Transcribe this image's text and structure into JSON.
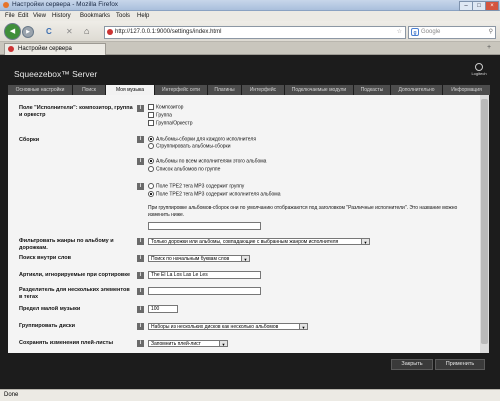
{
  "window": {
    "title": "Настройки сервера - Mozilla Firefox",
    "controls": {
      "minimize": "–",
      "maximize": "□",
      "close": "×"
    }
  },
  "menu": [
    "File",
    "Edit",
    "View",
    "History",
    "Bookmarks",
    "Tools",
    "Help"
  ],
  "navbar": {
    "back_icon": "◀",
    "forward_icon": "▶",
    "reload_icon": "C",
    "stop_icon": "✕",
    "home_icon": "⌂",
    "url": "http://127.0.0.1:9000/settings/index.html",
    "search_placeholder": "Google"
  },
  "browser_tab": {
    "label": "Настройки сервера"
  },
  "app": {
    "title": "Squeezebox™ Server",
    "logo_text": "Logitech",
    "tabs": [
      "Основные настройки",
      "Поиск",
      "Моя музыка",
      "Интерфейс сети",
      "Плагины",
      "Интерфейс",
      "Подключаемые модули",
      "Подкасты",
      "Дополнительно",
      "Информация"
    ],
    "active_tab_index": 2
  },
  "settings": {
    "hint_icon": "i",
    "composer": {
      "label": "Поле \"Исполнители\": композитор, группа и оркестр",
      "options": [
        {
          "text": "Композитор",
          "checked": false
        },
        {
          "text": "Группа",
          "checked": false
        },
        {
          "text": "Группа/Оркестр",
          "checked": false
        }
      ]
    },
    "compilations": {
      "label": "Сборки",
      "group1": [
        {
          "text": "Альбомы-сборки для каждого исполнителя",
          "checked": true
        },
        {
          "text": "Сгруппировать альбомы-сборки",
          "checked": false
        }
      ],
      "group2": [
        {
          "text": "Альбомы по всем исполнителям этого альбома",
          "checked": true
        },
        {
          "text": "Список альбомов по группе",
          "checked": false
        }
      ],
      "group3": [
        {
          "text": "Поле TPE2 тега MP3 содержит группу",
          "checked": false
        },
        {
          "text": "Поле TPE2 тега MP3 содержит исполнителя альбома",
          "checked": true
        }
      ],
      "note": "При группировке альбомов-сборок они по умолчанию отображаются под заголовком \"Различные исполнители\". Это название можно изменить ниже.",
      "name_value": ""
    },
    "genre_filter": {
      "label": "Фильтровать жанры по альбому и дорожкам.",
      "value": "Только дорожки или альбомы, совпадающие с выбранным жанром исполнителя"
    },
    "word_search": {
      "label": "Поиск внутри слов",
      "value": "Поиск по начальным буквам слов"
    },
    "articles": {
      "label": "Артикли, игнорируемые при сортировке",
      "value": "The El La Los Las Le Les"
    },
    "separators": {
      "label": "Разделитель для нескольких элементов в тегах",
      "value": ""
    },
    "short_music": {
      "label": "Предел малой музыки",
      "value": "100"
    },
    "group_discs": {
      "label": "Группировать диски",
      "value": "Наборы из нескольких дисков как несколько альбомов"
    },
    "playlist_edits": {
      "label": "Сохранять изменения плей-листы",
      "value": "Запомнить плей-лист"
    }
  },
  "buttons": {
    "close": "Закрыть",
    "apply": "Применить"
  },
  "status": "Done",
  "colors": {
    "page_bg": "#1c1c1c",
    "content_bg": "#f4f4f4",
    "active_tab": "#f2f2f2",
    "inactive_tab": "#4c4c4c"
  }
}
